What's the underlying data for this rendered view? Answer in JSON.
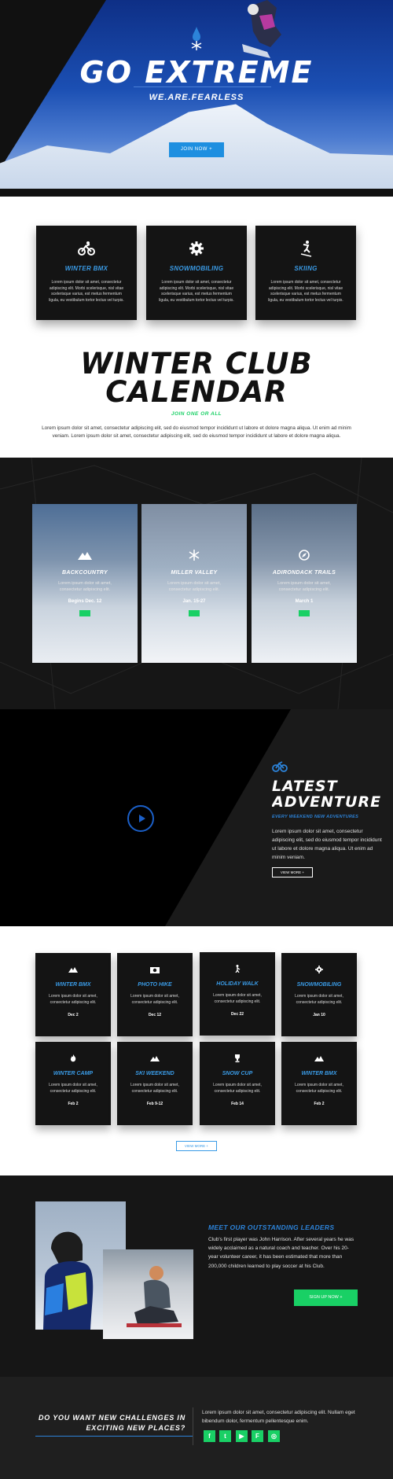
{
  "hero": {
    "title": "GO EXTREME",
    "subtitle": "WE.ARE.FEARLESS",
    "button": "JOIN NOW +"
  },
  "activities": [
    {
      "title": "WINTER BMX",
      "icon": "bmx-bike-icon",
      "text": "Lorem ipsum dolor sit amet, consectetur adipiscing elit. Morbi scelerisque, nisl vitae scelerisque varius, est metus fermentum ligula, eu vestibulum tortor lectus vel turpis."
    },
    {
      "title": "SNOWMOBILING",
      "icon": "gear-icon",
      "text": "Lorem ipsum dolor sit amet, consectetur adipiscing elit. Morbi scelerisque, nisl vitae scelerisque varius, est metus fermentum ligula, eu vestibulum tortor lectus vel turpis."
    },
    {
      "title": "SKIING",
      "icon": "skier-icon",
      "text": "Lorem ipsum dolor sit amet, consectetur adipiscing elit. Morbi scelerisque, nisl vitae scelerisque varius, est metus fermentum ligula, eu vestibulum tortor lectus vel turpis."
    }
  ],
  "calendar": {
    "title_line1": "WINTER CLUB",
    "title_line2": "CALENDAR",
    "subtitle": "JOIN ONE OR ALL",
    "description": "Lorem ipsum dolor sit amet, consectetur adipiscing elit, sed do eiusmod tempor incididunt ut labore et dolore magna aliqua. Ut enim ad minim veniam. Lorem ipsum dolor sit amet, consectetur adipiscing elit, sed do eiusmod tempor incididunt ut labore et dolore magna aliqua."
  },
  "events": [
    {
      "title": "BACKCOUNTRY",
      "icon": "mountain-icon",
      "text": "Lorem ipsum dolor sit amet, consectetur adipiscing elit.",
      "date": "Begins Dec. 12"
    },
    {
      "title": "MILLER VALLEY",
      "icon": "snowflake-icon",
      "text": "Lorem ipsum dolor sit amet, consectetur adipiscing elit.",
      "date": "Jan. 15-27"
    },
    {
      "title": "ADIRONDACK TRAILS",
      "icon": "compass-icon",
      "text": "Lorem ipsum dolor sit amet, consectetur adipiscing elit.",
      "date": "March 1"
    }
  ],
  "latest": {
    "title_line1": "LATEST",
    "title_line2": "ADVENTURE",
    "subtitle": "EVERY WEEKEND NEW ADVENTURES",
    "description": "Lorem ipsum dolor sit amet, consectetur adipiscing elit, sed do eiusmod tempor incididunt ut labore et dolore magna aliqua. Ut enim ad minim veniam.",
    "button": "VIEW MORE +"
  },
  "grid": [
    {
      "title": "WINTER BMX",
      "icon": "mountain-icon",
      "text": "Lorem ipsum dolor sit amet, consectetur adipiscing elit.",
      "date": "Dec 2"
    },
    {
      "title": "PHOTO HIKE",
      "icon": "camera-icon",
      "text": "Lorem ipsum dolor sit amet, consectetur adipiscing elit.",
      "date": "Dec 12"
    },
    {
      "title": "HOLIDAY WALK",
      "icon": "hiker-icon",
      "text": "Lorem ipsum dolor sit amet, consectetur adipiscing elit.",
      "date": "Dec 22"
    },
    {
      "title": "SNOWMOBILING",
      "icon": "gear-icon",
      "text": "Lorem ipsum dolor sit amet, consectetur adipiscing elit.",
      "date": "Jan 10"
    },
    {
      "title": "WINTER CAMP",
      "icon": "fire-icon",
      "text": "Lorem ipsum dolor sit amet, consectetur adipiscing elit.",
      "date": "Feb 2"
    },
    {
      "title": "SKI WEEKEND",
      "icon": "mountain-icon",
      "text": "Lorem ipsum dolor sit amet, consectetur adipiscing elit.",
      "date": "Feb 9-12"
    },
    {
      "title": "SNOW CUP",
      "icon": "trophy-icon",
      "text": "Lorem ipsum dolor sit amet, consectetur adipiscing elit.",
      "date": "Feb 14"
    },
    {
      "title": "WINTER BMX",
      "icon": "mountain-icon",
      "text": "Lorem ipsum dolor sit amet, consectetur adipiscing elit.",
      "date": "Feb 2"
    }
  ],
  "grid_button": "VIEW MORE +",
  "leaders": {
    "title": "MEET OUR OUTSTANDING LEADERS",
    "description": "Club's first player was John Harrison. After several years he was widely acclaimed as a natural coach and teacher. Over his 20-year volunteer career, it has been estimated that more than 200,000 children learned to play soccer at his Club.",
    "button": "SIGN UP NOW +"
  },
  "footer": {
    "question_line1": "DO YOU WANT NEW CHALLENGES IN",
    "question_line2": "EXCITING NEW PLACES?",
    "description": "Lorem ipsum dolor sit amet, consectetur adipiscing elit. Nullam eget bibendum dolor, fermentum pellentesque enim.",
    "social": [
      {
        "icon": "facebook-icon",
        "glyph": "f"
      },
      {
        "icon": "twitter-icon",
        "glyph": "t"
      },
      {
        "icon": "youtube-icon",
        "glyph": "▶"
      },
      {
        "icon": "foursquare-icon",
        "glyph": "F"
      },
      {
        "icon": "instagram-icon",
        "glyph": "◎"
      }
    ]
  },
  "colors": {
    "accent_blue": "#2c83d9",
    "accent_green": "#19d065",
    "dark": "#161616"
  }
}
